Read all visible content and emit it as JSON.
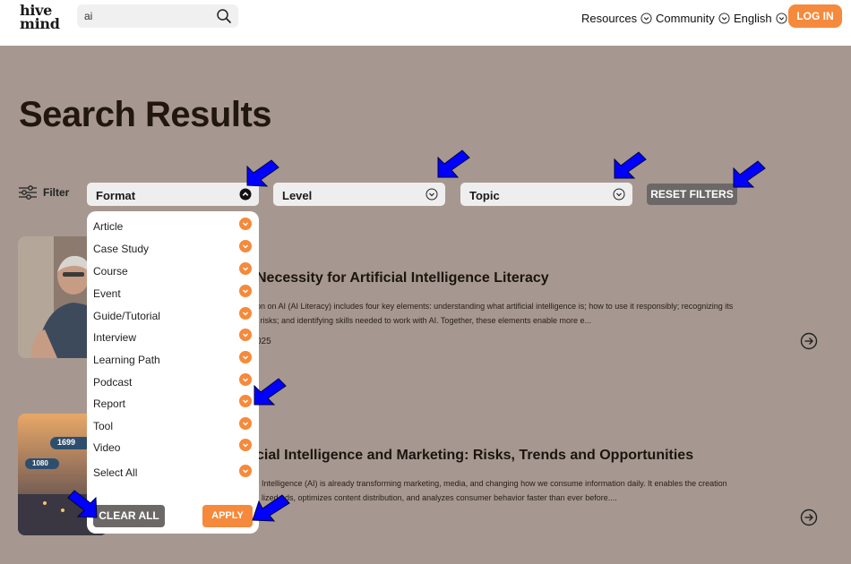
{
  "header": {
    "logo_line1": "hive",
    "logo_line2": "mind",
    "search_value": "ai",
    "nav_resources": "Resources",
    "nav_community": "Community",
    "nav_language": "English",
    "login_label": "LOG IN"
  },
  "page_title": "Search Results",
  "filters": {
    "filter_label": "Filter",
    "format_label": "Format",
    "level_label": "Level",
    "topic_label": "Topic",
    "reset_label": "RESET FILTERS"
  },
  "format_dropdown": {
    "options": [
      "Article",
      "Case Study",
      "Course",
      "Event",
      "Guide/Tutorial",
      "Interview",
      "Learning Path",
      "Podcast",
      "Report",
      "Tool",
      "Video"
    ],
    "select_all_label": "Select All",
    "clear_label": "CLEAR ALL",
    "apply_label": "APPLY"
  },
  "results": [
    {
      "title": "Necessity for Artificial Intelligence Literacy",
      "excerpt_line1": "on on AI (AI Literacy) includes four key elements: understanding what artificial intelligence is; how to use it responsibly; recognizing its",
      "excerpt_line2": "l risks; and identifying skills needed to work with AI. Together, these elements enable more e...",
      "date": "025"
    },
    {
      "title": "cial Intelligence and Marketing: Risks, Trends and Opportunities",
      "excerpt_line1": "Intelligence (AI) is already transforming marketing, media, and changing how we consume information daily. It enables the creation",
      "excerpt_line2": "lized ads, optimizes content distribution, and analyzes consumer behavior faster than ever before....",
      "image_labels": [
        "1699",
        "1080"
      ]
    }
  ],
  "colors": {
    "accent": "#f58a3c",
    "page_bg": "#a69890",
    "button_gray": "#6c6868",
    "annotation_arrow": "#0000ff"
  }
}
